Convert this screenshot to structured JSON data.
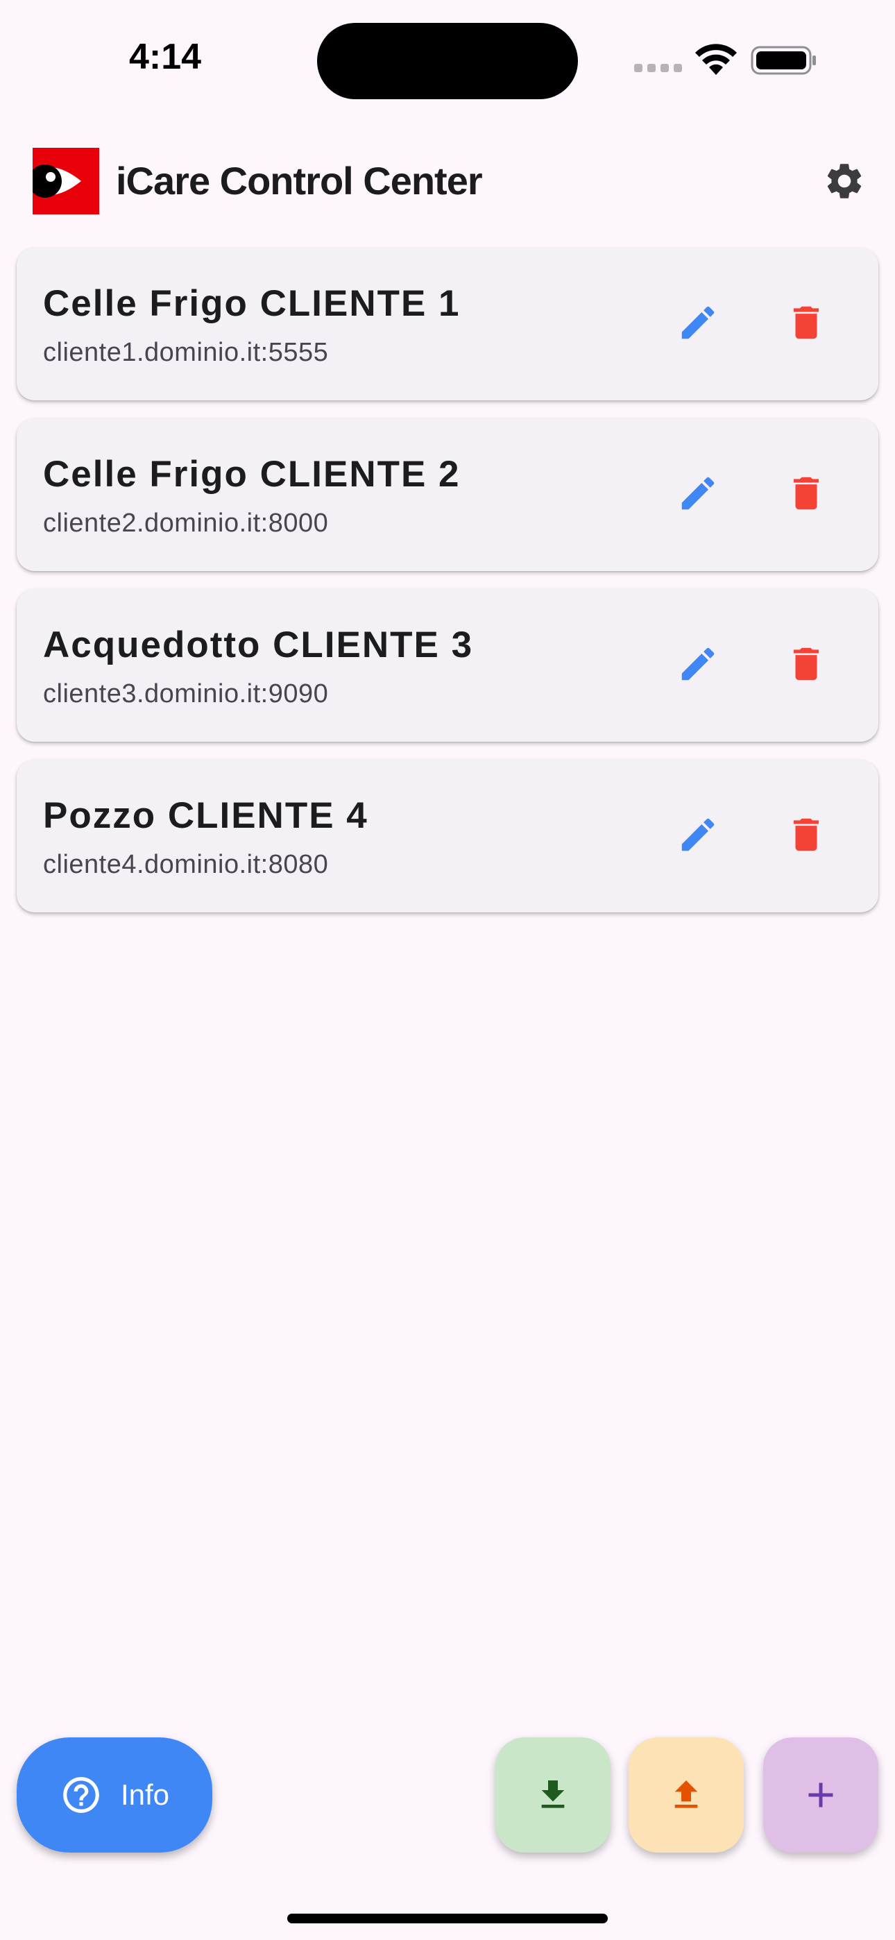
{
  "status_bar": {
    "time": "4:14"
  },
  "app_bar": {
    "title": "iCare Control Center",
    "logo_icon": "icare-eye-logo",
    "settings_icon": "gear-icon"
  },
  "servers": [
    {
      "name": "Celle Frigo CLIENTE 1",
      "address": "cliente1.dominio.it:5555"
    },
    {
      "name": "Celle Frigo CLIENTE 2",
      "address": "cliente2.dominio.it:8000"
    },
    {
      "name": "Acquedotto CLIENTE 3",
      "address": "cliente3.dominio.it:9090"
    },
    {
      "name": "Pozzo CLIENTE 4",
      "address": "cliente4.dominio.it:8080"
    }
  ],
  "actions": {
    "info_label": "Info",
    "download_icon": "download-icon",
    "upload_icon": "upload-icon",
    "add_icon": "plus-icon"
  },
  "colors": {
    "edit": "#3f87f5",
    "delete": "#f44336",
    "info_bg": "#3f87f5",
    "download_fg": "#1e5b1e",
    "upload_fg": "#e65100",
    "add_fg": "#6a3aa8",
    "logo_bg": "#e8000b"
  }
}
